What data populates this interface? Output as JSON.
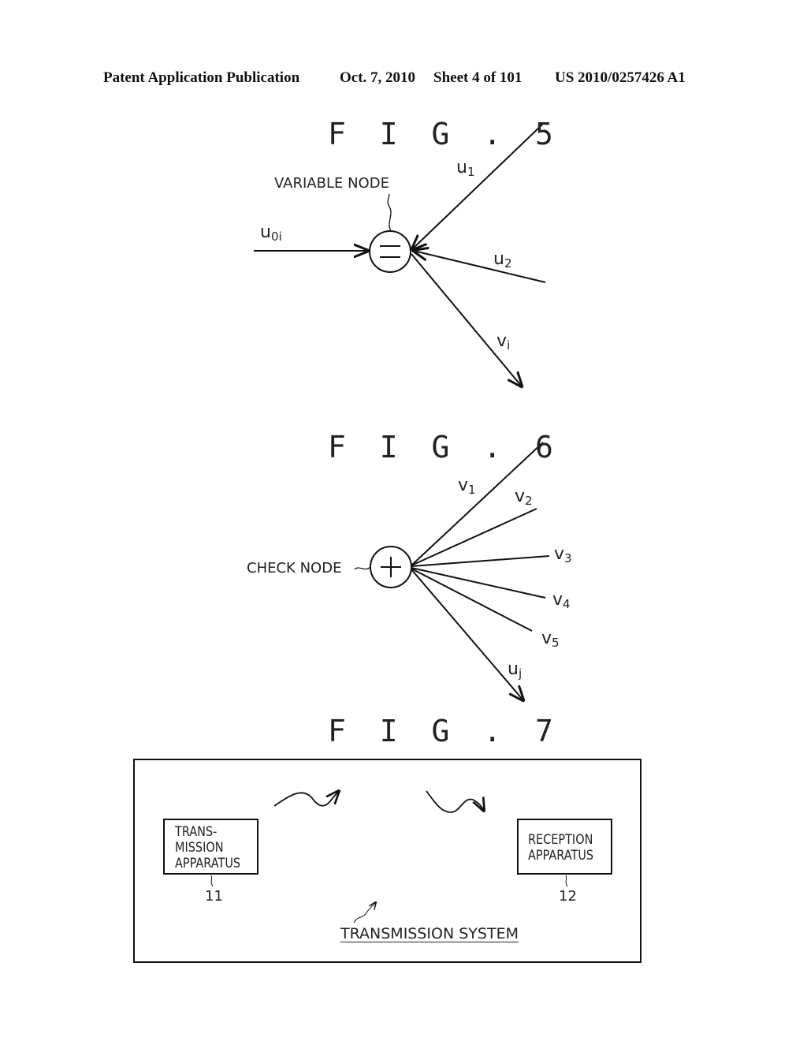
{
  "header": {
    "publication": "Patent Application Publication",
    "date": "Oct. 7, 2010",
    "sheet": "Sheet 4 of 101",
    "number": "US 2010/0257426 A1"
  },
  "fig5": {
    "title": "F I G . 5",
    "node_label": "VARIABLE NODE",
    "node_symbol": "=",
    "input_label": {
      "base": "u",
      "sub": "0i"
    },
    "incoming": [
      {
        "base": "u",
        "sub": "1"
      },
      {
        "base": "u",
        "sub": "2"
      }
    ],
    "output": {
      "base": "v",
      "sub": "i"
    }
  },
  "fig6": {
    "title": "F I G . 6",
    "node_label": "CHECK NODE",
    "node_symbol": "+",
    "incoming": [
      {
        "base": "v",
        "sub": "1"
      },
      {
        "base": "v",
        "sub": "2"
      },
      {
        "base": "v",
        "sub": "3"
      },
      {
        "base": "v",
        "sub": "4"
      },
      {
        "base": "v",
        "sub": "5"
      }
    ],
    "output": {
      "base": "u",
      "sub": "j"
    }
  },
  "fig7": {
    "title": "F I G . 7",
    "transmitter": {
      "lines": [
        "TRANS-",
        "MISSION",
        "APPARATUS"
      ],
      "ref": "11"
    },
    "receiver": {
      "lines": [
        "RECEPTION",
        "APPARATUS"
      ],
      "ref": "12"
    },
    "system_label": "TRANSMISSION SYSTEM"
  }
}
